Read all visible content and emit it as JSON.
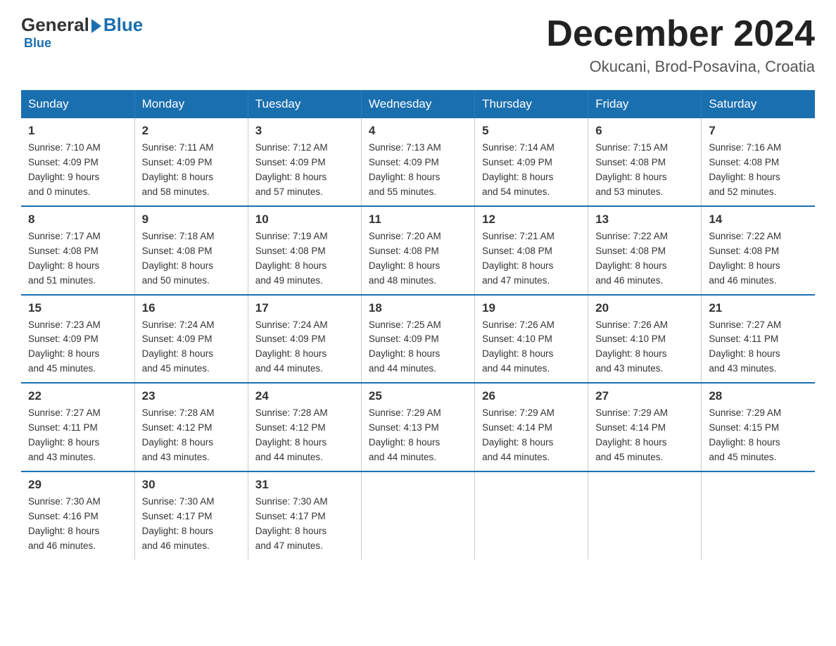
{
  "logo": {
    "general": "General",
    "blue": "Blue"
  },
  "header": {
    "month_year": "December 2024",
    "location": "Okucani, Brod-Posavina, Croatia"
  },
  "days_of_week": [
    "Sunday",
    "Monday",
    "Tuesday",
    "Wednesday",
    "Thursday",
    "Friday",
    "Saturday"
  ],
  "weeks": [
    [
      {
        "day": "1",
        "sunrise": "7:10 AM",
        "sunset": "4:09 PM",
        "daylight": "9 hours and 0 minutes."
      },
      {
        "day": "2",
        "sunrise": "7:11 AM",
        "sunset": "4:09 PM",
        "daylight": "8 hours and 58 minutes."
      },
      {
        "day": "3",
        "sunrise": "7:12 AM",
        "sunset": "4:09 PM",
        "daylight": "8 hours and 57 minutes."
      },
      {
        "day": "4",
        "sunrise": "7:13 AM",
        "sunset": "4:09 PM",
        "daylight": "8 hours and 55 minutes."
      },
      {
        "day": "5",
        "sunrise": "7:14 AM",
        "sunset": "4:09 PM",
        "daylight": "8 hours and 54 minutes."
      },
      {
        "day": "6",
        "sunrise": "7:15 AM",
        "sunset": "4:08 PM",
        "daylight": "8 hours and 53 minutes."
      },
      {
        "day": "7",
        "sunrise": "7:16 AM",
        "sunset": "4:08 PM",
        "daylight": "8 hours and 52 minutes."
      }
    ],
    [
      {
        "day": "8",
        "sunrise": "7:17 AM",
        "sunset": "4:08 PM",
        "daylight": "8 hours and 51 minutes."
      },
      {
        "day": "9",
        "sunrise": "7:18 AM",
        "sunset": "4:08 PM",
        "daylight": "8 hours and 50 minutes."
      },
      {
        "day": "10",
        "sunrise": "7:19 AM",
        "sunset": "4:08 PM",
        "daylight": "8 hours and 49 minutes."
      },
      {
        "day": "11",
        "sunrise": "7:20 AM",
        "sunset": "4:08 PM",
        "daylight": "8 hours and 48 minutes."
      },
      {
        "day": "12",
        "sunrise": "7:21 AM",
        "sunset": "4:08 PM",
        "daylight": "8 hours and 47 minutes."
      },
      {
        "day": "13",
        "sunrise": "7:22 AM",
        "sunset": "4:08 PM",
        "daylight": "8 hours and 46 minutes."
      },
      {
        "day": "14",
        "sunrise": "7:22 AM",
        "sunset": "4:08 PM",
        "daylight": "8 hours and 46 minutes."
      }
    ],
    [
      {
        "day": "15",
        "sunrise": "7:23 AM",
        "sunset": "4:09 PM",
        "daylight": "8 hours and 45 minutes."
      },
      {
        "day": "16",
        "sunrise": "7:24 AM",
        "sunset": "4:09 PM",
        "daylight": "8 hours and 45 minutes."
      },
      {
        "day": "17",
        "sunrise": "7:24 AM",
        "sunset": "4:09 PM",
        "daylight": "8 hours and 44 minutes."
      },
      {
        "day": "18",
        "sunrise": "7:25 AM",
        "sunset": "4:09 PM",
        "daylight": "8 hours and 44 minutes."
      },
      {
        "day": "19",
        "sunrise": "7:26 AM",
        "sunset": "4:10 PM",
        "daylight": "8 hours and 44 minutes."
      },
      {
        "day": "20",
        "sunrise": "7:26 AM",
        "sunset": "4:10 PM",
        "daylight": "8 hours and 43 minutes."
      },
      {
        "day": "21",
        "sunrise": "7:27 AM",
        "sunset": "4:11 PM",
        "daylight": "8 hours and 43 minutes."
      }
    ],
    [
      {
        "day": "22",
        "sunrise": "7:27 AM",
        "sunset": "4:11 PM",
        "daylight": "8 hours and 43 minutes."
      },
      {
        "day": "23",
        "sunrise": "7:28 AM",
        "sunset": "4:12 PM",
        "daylight": "8 hours and 43 minutes."
      },
      {
        "day": "24",
        "sunrise": "7:28 AM",
        "sunset": "4:12 PM",
        "daylight": "8 hours and 44 minutes."
      },
      {
        "day": "25",
        "sunrise": "7:29 AM",
        "sunset": "4:13 PM",
        "daylight": "8 hours and 44 minutes."
      },
      {
        "day": "26",
        "sunrise": "7:29 AM",
        "sunset": "4:14 PM",
        "daylight": "8 hours and 44 minutes."
      },
      {
        "day": "27",
        "sunrise": "7:29 AM",
        "sunset": "4:14 PM",
        "daylight": "8 hours and 45 minutes."
      },
      {
        "day": "28",
        "sunrise": "7:29 AM",
        "sunset": "4:15 PM",
        "daylight": "8 hours and 45 minutes."
      }
    ],
    [
      {
        "day": "29",
        "sunrise": "7:30 AM",
        "sunset": "4:16 PM",
        "daylight": "8 hours and 46 minutes."
      },
      {
        "day": "30",
        "sunrise": "7:30 AM",
        "sunset": "4:17 PM",
        "daylight": "8 hours and 46 minutes."
      },
      {
        "day": "31",
        "sunrise": "7:30 AM",
        "sunset": "4:17 PM",
        "daylight": "8 hours and 47 minutes."
      },
      {
        "day": "",
        "sunrise": "",
        "sunset": "",
        "daylight": ""
      },
      {
        "day": "",
        "sunrise": "",
        "sunset": "",
        "daylight": ""
      },
      {
        "day": "",
        "sunrise": "",
        "sunset": "",
        "daylight": ""
      },
      {
        "day": "",
        "sunrise": "",
        "sunset": "",
        "daylight": ""
      }
    ]
  ],
  "labels": {
    "sunrise": "Sunrise:",
    "sunset": "Sunset:",
    "daylight": "Daylight:"
  }
}
